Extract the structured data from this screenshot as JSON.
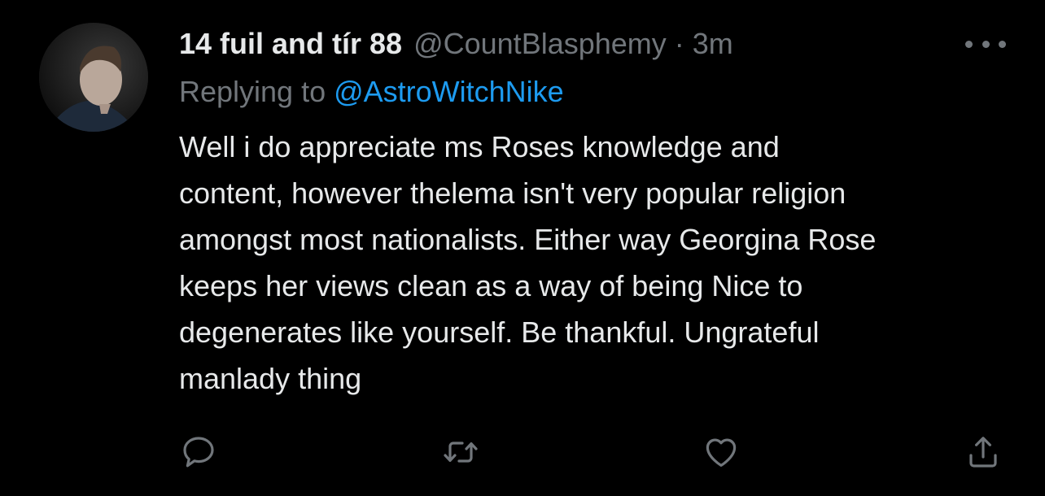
{
  "tweet": {
    "display_name": "14 fuil and tír 88",
    "handle": "@CountBlasphemy",
    "separator": "·",
    "time": "3m",
    "replying_prefix": "Replying to ",
    "replying_to": "@AstroWitchNike",
    "text": "Well i do appreciate ms Roses knowledge and\ncontent, however thelema isn't very popular religion\namongst most nationalists. Either way Georgina Rose\nkeeps her views clean as a way of being Nice to\ndegenerates like yourself. Be thankful. Ungrateful\nmanlady thing"
  },
  "icons": {
    "more": "more-horizontal-icon",
    "reply": "reply-icon",
    "retweet": "retweet-icon",
    "like": "like-icon",
    "share": "share-icon"
  },
  "colors": {
    "background": "#000000",
    "primary_text": "#e7e9ea",
    "secondary_text": "#71767b",
    "link": "#1d9bf0"
  }
}
